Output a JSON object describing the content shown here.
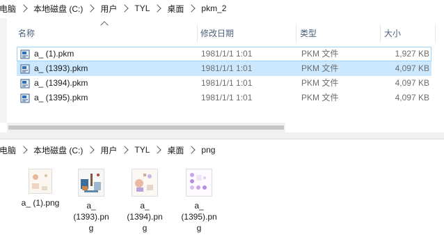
{
  "top_breadcrumb": [
    "此电脑",
    "本地磁盘 (C:)",
    "用户",
    "TYL",
    "桌面",
    "pkm_2"
  ],
  "columns": {
    "name": "名称",
    "modified": "修改日期",
    "type": "类型",
    "size": "大小"
  },
  "files": [
    {
      "name": "a_ (1).pkm",
      "modified": "1981/1/1 1:01",
      "type": "PKM 文件",
      "size": "1,927 KB"
    },
    {
      "name": "a_ (1393).pkm",
      "modified": "1981/1/1 1:01",
      "type": "PKM 文件",
      "size": "4,097 KB"
    },
    {
      "name": "a_ (1394).pkm",
      "modified": "1981/1/1 1:01",
      "type": "PKM 文件",
      "size": "4,097 KB"
    },
    {
      "name": "a_ (1395).pkm",
      "modified": "1981/1/1 1:01",
      "type": "PKM 文件",
      "size": "4,097 KB"
    }
  ],
  "bottom_breadcrumb": [
    "此电脑",
    "本地磁盘 (C:)",
    "用户",
    "TYL",
    "桌面",
    "png"
  ],
  "thumbnails": [
    {
      "label_lines": [
        "a_ (1).png"
      ]
    },
    {
      "label_lines": [
        "a_",
        "(1393).pn",
        "g"
      ]
    },
    {
      "label_lines": [
        "a_",
        "(1394).pn",
        "g"
      ]
    },
    {
      "label_lines": [
        "a_",
        "(1395).pn",
        "g"
      ]
    }
  ],
  "colors": {
    "selection": "#cce8ff",
    "focus_border": "#99d1ff",
    "header_text": "#4c607a"
  },
  "icons": {
    "file": "pkm-file-icon",
    "thumb": "image-thumbnail"
  }
}
